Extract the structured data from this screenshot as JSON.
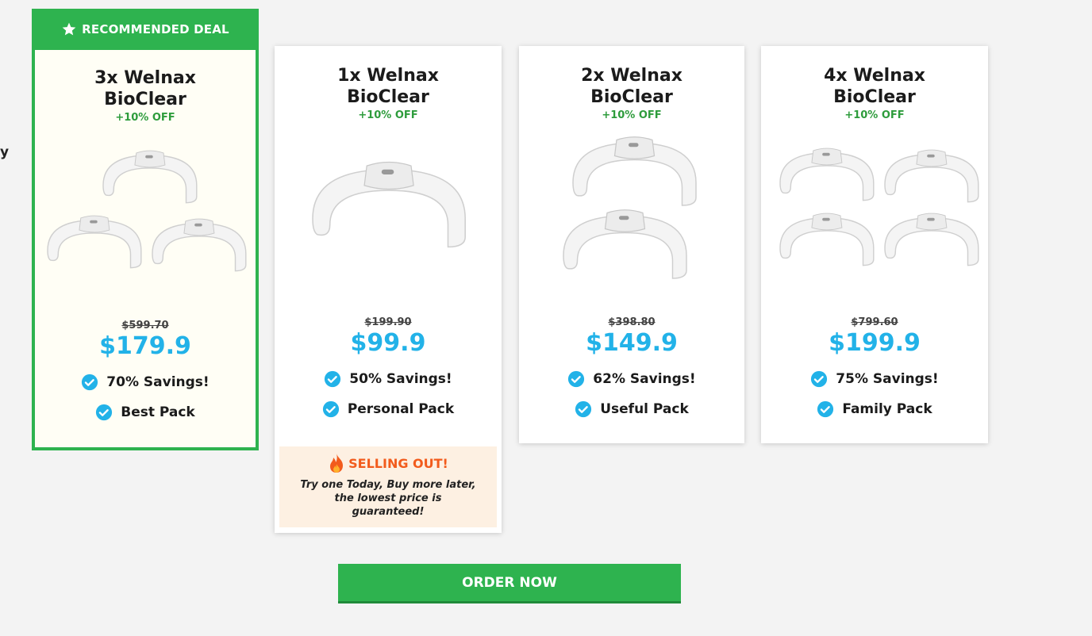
{
  "stray_text": "y",
  "recommended_label": "RECOMMENDED DEAL",
  "cards": [
    {
      "title_line1": "3x Welnax",
      "title_line2": "BioClear",
      "discount": "+10% OFF",
      "old_price": "$599.70",
      "new_price": "$179.9",
      "savings": "70% Savings!",
      "pack": "Best Pack",
      "units": 3
    },
    {
      "title_line1": "1x Welnax",
      "title_line2": "BioClear",
      "discount": "+10% OFF",
      "old_price": "$199.90",
      "new_price": "$99.9",
      "savings": "50% Savings!",
      "pack": "Personal Pack",
      "units": 1
    },
    {
      "title_line1": "2x Welnax",
      "title_line2": "BioClear",
      "discount": "+10% OFF",
      "old_price": "$398.80",
      "new_price": "$149.9",
      "savings": "62% Savings!",
      "pack": "Useful Pack",
      "units": 2
    },
    {
      "title_line1": "4x Welnax",
      "title_line2": "BioClear",
      "discount": "+10% OFF",
      "old_price": "$799.60",
      "new_price": "$199.9",
      "savings": "75% Savings!",
      "pack": "Family Pack",
      "units": 4
    }
  ],
  "selling_out": {
    "heading": "SELLING OUT!",
    "text": "Try one Today, Buy more later, the lowest price is guaranteed!"
  },
  "order_button": "ORDER NOW",
  "colors": {
    "accent_green": "#2eb34f",
    "price_blue": "#22b2e8",
    "discount_green": "#2e9c3c",
    "fire_orange": "#f25b1c"
  }
}
